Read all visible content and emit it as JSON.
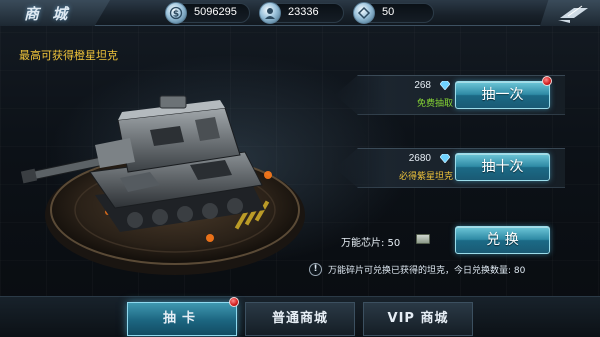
{
  "header": {
    "title": "商 城",
    "currencies": [
      {
        "icon": "silver-coin-icon",
        "glyph": "$",
        "value": "5096295"
      },
      {
        "icon": "crew-medal-icon",
        "glyph": "",
        "value": "23336"
      },
      {
        "icon": "gold-coin-icon",
        "glyph": "",
        "value": "50"
      }
    ],
    "back_icon": "back-arrow-icon"
  },
  "subtitle": "最高可获得橙星坦克",
  "offers": [
    {
      "price": "268",
      "note": "免费抽取",
      "button": "抽一次",
      "badge": true
    },
    {
      "price": "2680",
      "note": "必得紫星坦克",
      "button": "抽十次",
      "badge": false
    }
  ],
  "exchange": {
    "chips_label": "万能芯片: 50",
    "button": "兑 换",
    "info": "万能碎片可兑换已获得的坦克，今日兑换数量: 80"
  },
  "tabs": [
    {
      "label": "抽卡",
      "active": true,
      "badge": true
    },
    {
      "label": "普通商城",
      "active": false,
      "badge": false
    },
    {
      "label": "VIP 商城",
      "active": false,
      "badge": false
    }
  ],
  "colors": {
    "accent": "#2e8aa5",
    "highlight_text": "#f0c43a",
    "free_text": "#86d534",
    "badge": "#d11d1d"
  }
}
